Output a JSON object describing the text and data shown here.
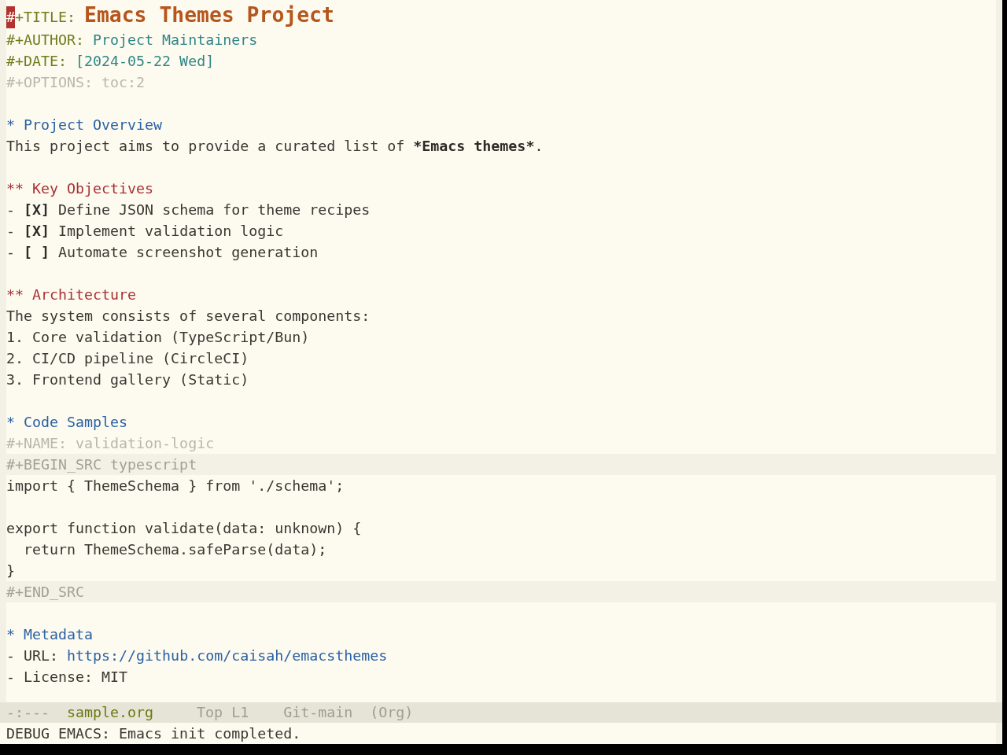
{
  "buffer": {
    "lines": [
      {
        "kind": "title",
        "key": "#+TITLE:",
        "value": "Emacs Themes Project",
        "cursor": true
      },
      {
        "kind": "keyword",
        "key": "#+AUTHOR:",
        "value": "Project Maintainers",
        "cursor": false
      },
      {
        "kind": "keyword",
        "key": "#+DATE:",
        "value": "[2024-05-22 Wed]",
        "cursor": false
      },
      {
        "kind": "meta",
        "text": "#+OPTIONS: toc:2"
      },
      {
        "kind": "blank"
      },
      {
        "kind": "section",
        "text": "* Project Overview"
      },
      {
        "kind": "paragraph",
        "parts": [
          {
            "text": "This project aims to provide a curated list of ",
            "bold": false
          },
          {
            "text": "*Emacs themes*",
            "bold": true
          },
          {
            "text": ".",
            "bold": false
          }
        ]
      },
      {
        "kind": "blank"
      },
      {
        "kind": "subsection",
        "text": "** Key Objectives"
      },
      {
        "kind": "paragraph",
        "parts": [
          {
            "text": "- ",
            "bold": false
          },
          {
            "text": "[X]",
            "bold": true
          },
          {
            "text": " Define JSON schema for theme recipes",
            "bold": false
          }
        ]
      },
      {
        "kind": "paragraph",
        "parts": [
          {
            "text": "- ",
            "bold": false
          },
          {
            "text": "[X]",
            "bold": true
          },
          {
            "text": " Implement validation logic",
            "bold": false
          }
        ]
      },
      {
        "kind": "paragraph",
        "parts": [
          {
            "text": "- ",
            "bold": false
          },
          {
            "text": "[ ]",
            "bold": true
          },
          {
            "text": " Automate screenshot generation",
            "bold": false
          }
        ]
      },
      {
        "kind": "blank"
      },
      {
        "kind": "subsection",
        "text": "** Architecture"
      },
      {
        "kind": "paragraph",
        "parts": [
          {
            "text": "The system consists of several components:",
            "bold": false
          }
        ]
      },
      {
        "kind": "paragraph",
        "parts": [
          {
            "text": "1. Core validation (TypeScript/Bun)",
            "bold": false
          }
        ]
      },
      {
        "kind": "paragraph",
        "parts": [
          {
            "text": "2. CI/CD pipeline (CircleCI)",
            "bold": false
          }
        ]
      },
      {
        "kind": "paragraph",
        "parts": [
          {
            "text": "3. Frontend gallery (Static)",
            "bold": false
          }
        ]
      },
      {
        "kind": "blank"
      },
      {
        "kind": "section",
        "text": "* Code Samples"
      },
      {
        "kind": "meta",
        "text": "#+NAME: validation-logic"
      },
      {
        "kind": "delimiter",
        "text": "#+BEGIN_SRC typescript"
      },
      {
        "kind": "code",
        "text": "import { ThemeSchema } from './schema';"
      },
      {
        "kind": "blank"
      },
      {
        "kind": "code",
        "text": "export function validate(data: unknown) {"
      },
      {
        "kind": "code",
        "text": "  return ThemeSchema.safeParse(data);"
      },
      {
        "kind": "code",
        "text": "}"
      },
      {
        "kind": "delimiter",
        "text": "#+END_SRC"
      },
      {
        "kind": "blank"
      },
      {
        "kind": "section",
        "text": "* Metadata"
      },
      {
        "kind": "link",
        "text": "- URL: ",
        "url": "https://github.com/caisah/emacsthemes"
      },
      {
        "kind": "paragraph",
        "parts": [
          {
            "text": "- License: MIT",
            "bold": false
          }
        ]
      }
    ]
  },
  "mode_line": {
    "status": "-:---",
    "buffer_name": "sample.org",
    "position": "Top L1",
    "vc_branch": "Git-main",
    "major_mode": "(Org)"
  },
  "echo_area": {
    "message": "DEBUG EMACS: Emacs init completed."
  }
}
